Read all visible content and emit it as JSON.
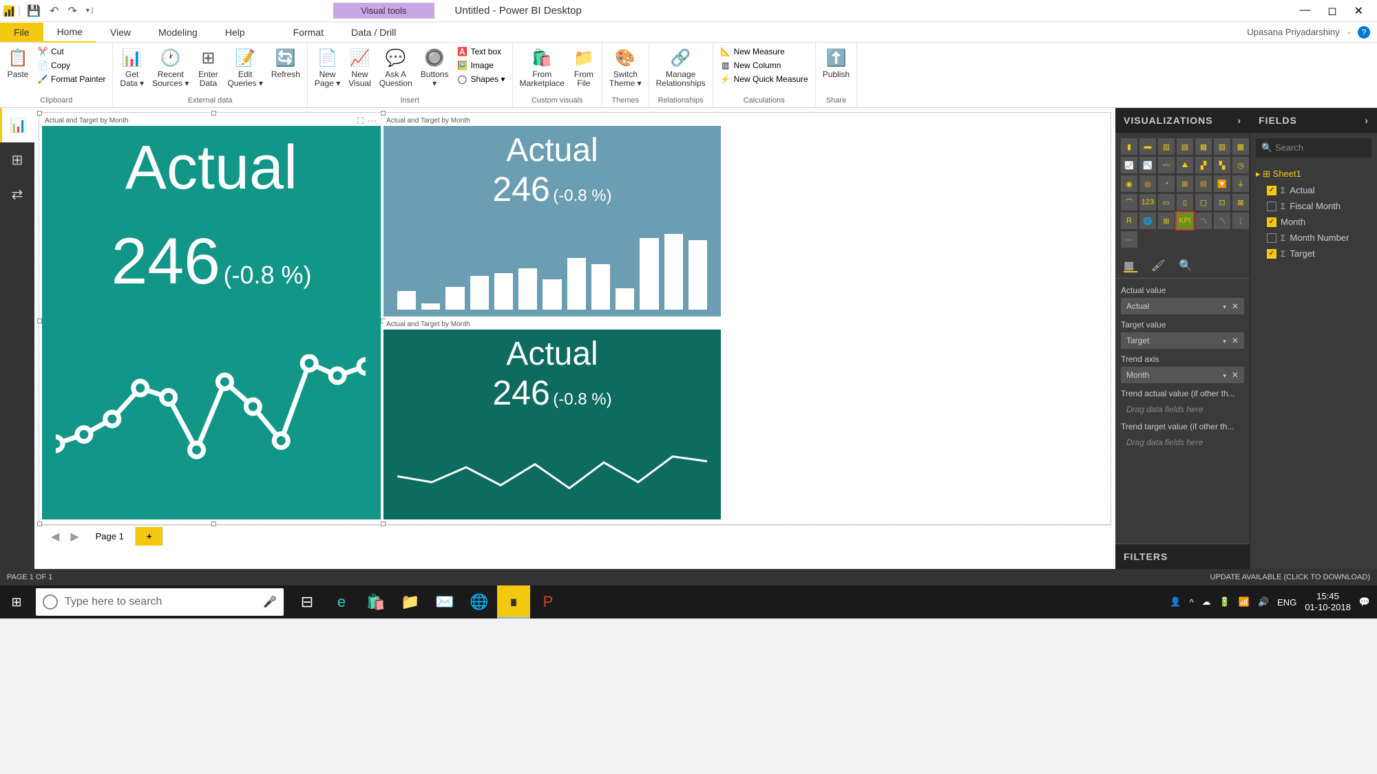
{
  "titlebar": {
    "visual_tools": "Visual tools",
    "doc_title": "Untitled - Power BI Desktop"
  },
  "menu": {
    "file": "File",
    "items": [
      "Home",
      "View",
      "Modeling",
      "Help",
      "Format",
      "Data / Drill"
    ],
    "user": "Upasana Priyadarshiny"
  },
  "ribbon": {
    "clipboard": {
      "paste": "Paste",
      "cut": "Cut",
      "copy": "Copy",
      "format_painter": "Format Painter",
      "group": "Clipboard"
    },
    "external": {
      "get_data": "Get\nData ▾",
      "recent": "Recent\nSources ▾",
      "enter": "Enter\nData",
      "edit": "Edit\nQueries ▾",
      "refresh": "Refresh",
      "group": "External data"
    },
    "insert": {
      "new_page": "New\nPage ▾",
      "new_visual": "New\nVisual",
      "ask": "Ask A\nQuestion",
      "buttons": "Buttons\n▾",
      "textbox": "Text box",
      "image": "Image",
      "shapes": "Shapes ▾",
      "group": "Insert"
    },
    "custom": {
      "marketplace": "From\nMarketplace",
      "file": "From\nFile",
      "group": "Custom visuals"
    },
    "themes": {
      "switch": "Switch\nTheme ▾",
      "group": "Themes"
    },
    "rel": {
      "manage": "Manage\nRelationships",
      "group": "Relationships"
    },
    "calc": {
      "measure": "New Measure",
      "column": "New Column",
      "quick": "New Quick Measure",
      "group": "Calculations"
    },
    "share": {
      "publish": "Publish",
      "group": "Share"
    }
  },
  "kpi": {
    "header": "Actual  and Target by Month",
    "title": "Actual",
    "value": "246",
    "pct": "(-0.8 %)"
  },
  "chart_data": [
    {
      "type": "line",
      "name": "kpi1-trend-markers",
      "values": [
        100,
        115,
        140,
        190,
        175,
        90,
        200,
        160,
        105,
        230,
        210,
        225
      ]
    },
    {
      "type": "bar",
      "name": "kpi2-bars",
      "values": [
        25,
        8,
        30,
        45,
        48,
        55,
        40,
        68,
        60,
        28,
        95,
        100,
        92
      ]
    },
    {
      "type": "line",
      "name": "kpi3-trend",
      "values": [
        55,
        45,
        70,
        40,
        75,
        35,
        78,
        45,
        88,
        80
      ]
    }
  ],
  "pages": {
    "p1": "Page 1",
    "status": "PAGE 1 OF 1",
    "update": "UPDATE AVAILABLE (CLICK TO DOWNLOAD)"
  },
  "viz_panel": {
    "title": "VISUALIZATIONS",
    "wells": {
      "actual_label": "Actual value",
      "actual_pill": "Actual",
      "target_label": "Target value",
      "target_pill": "Target",
      "trend_label": "Trend axis",
      "trend_pill": "Month",
      "trend_actual_label": "Trend actual value (if other th...",
      "trend_target_label": "Trend target value (if other th...",
      "drag": "Drag data fields here"
    },
    "filters": "FILTERS"
  },
  "fields_panel": {
    "title": "FIELDS",
    "search": "Search",
    "table": "Sheet1",
    "fields": [
      {
        "name": "Actual",
        "checked": true,
        "sigma": true
      },
      {
        "name": "Fiscal Month",
        "checked": false,
        "sigma": true
      },
      {
        "name": "Month",
        "checked": true,
        "sigma": false
      },
      {
        "name": "Month Number",
        "checked": false,
        "sigma": true
      },
      {
        "name": "Target",
        "checked": true,
        "sigma": true
      }
    ]
  },
  "taskbar": {
    "search_placeholder": "Type here to search",
    "lang": "ENG",
    "time": "15:45",
    "date": "01-10-2018"
  }
}
